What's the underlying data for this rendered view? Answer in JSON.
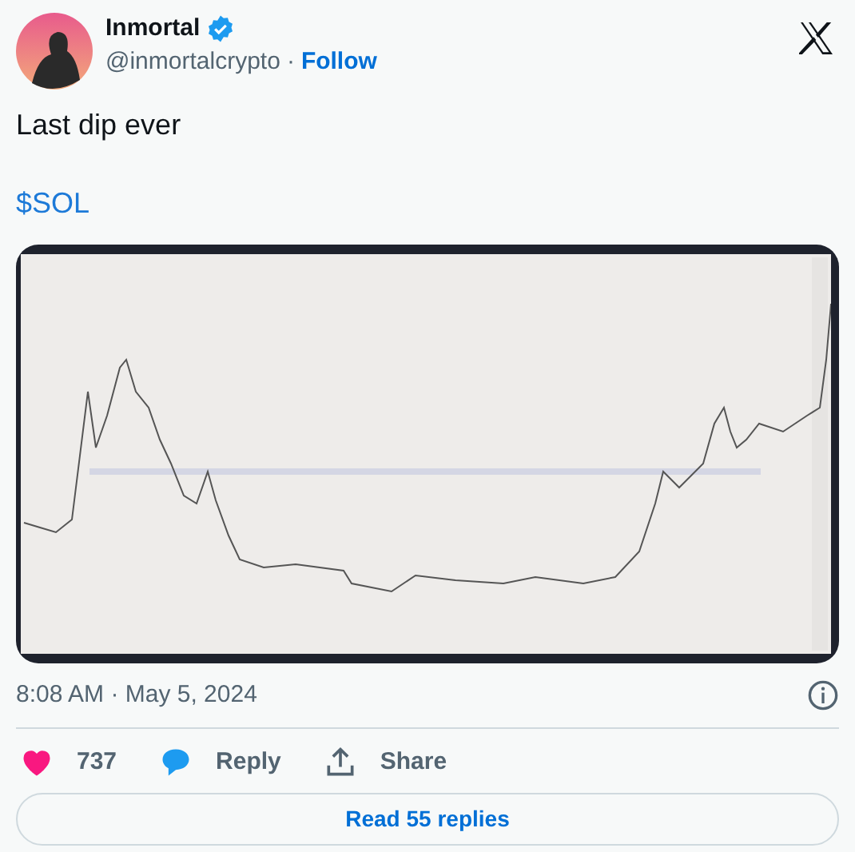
{
  "author": {
    "name": "Inmortal",
    "verified": true,
    "handle": "@inmortalcrypto",
    "separator": "·",
    "follow": "Follow"
  },
  "text": [
    "Last dip ever",
    "$SOL"
  ],
  "media": {
    "kind": "chart"
  },
  "timestamp": "8:08 AM · May 5, 2024",
  "actions": [
    {
      "kind": "like",
      "label": "737"
    },
    {
      "kind": "reply",
      "label": "Reply"
    },
    {
      "kind": "share",
      "label": "Share"
    }
  ],
  "read_replies": "Read 55 replies"
}
